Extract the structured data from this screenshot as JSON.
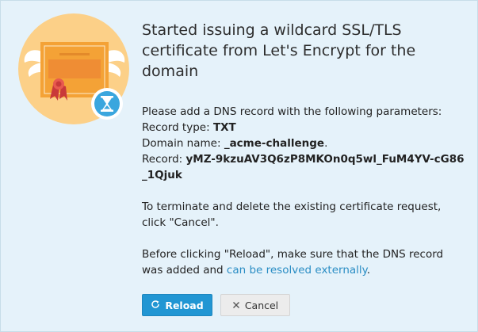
{
  "dialog": {
    "title": "Started issuing a wildcard SSL/TLS certificate from Let's Encrypt for the domain",
    "intro": "Please add a DNS record with the following parameters:",
    "record_type_label": "Record type: ",
    "record_type_value": "TXT",
    "domain_name_label": "Domain name: ",
    "domain_name_value": "_acme-challenge",
    "domain_name_suffix": ".",
    "record_label": "Record: ",
    "record_value": "yMZ-9kzuAV3Q6zP8MKOn0q5wl_FuM4YV-cG86_1Qjuk",
    "terminate_text": "To terminate and delete the existing certificate request, click \"Cancel\".",
    "reload_text_before": "Before clicking \"Reload\", make sure that the DNS record was added and ",
    "reload_link": "can be resolved externally",
    "reload_text_after": "."
  },
  "buttons": {
    "reload_label": "Reload",
    "reload_icon": "refresh-icon",
    "cancel_label": "Cancel",
    "cancel_icon": "close-icon"
  },
  "colors": {
    "panel_bg": "#e5f2fa",
    "accent": "#2196d3",
    "link": "#2a8dc4",
    "badge_circle": "#fcd088",
    "certificate": "#f4a236"
  }
}
